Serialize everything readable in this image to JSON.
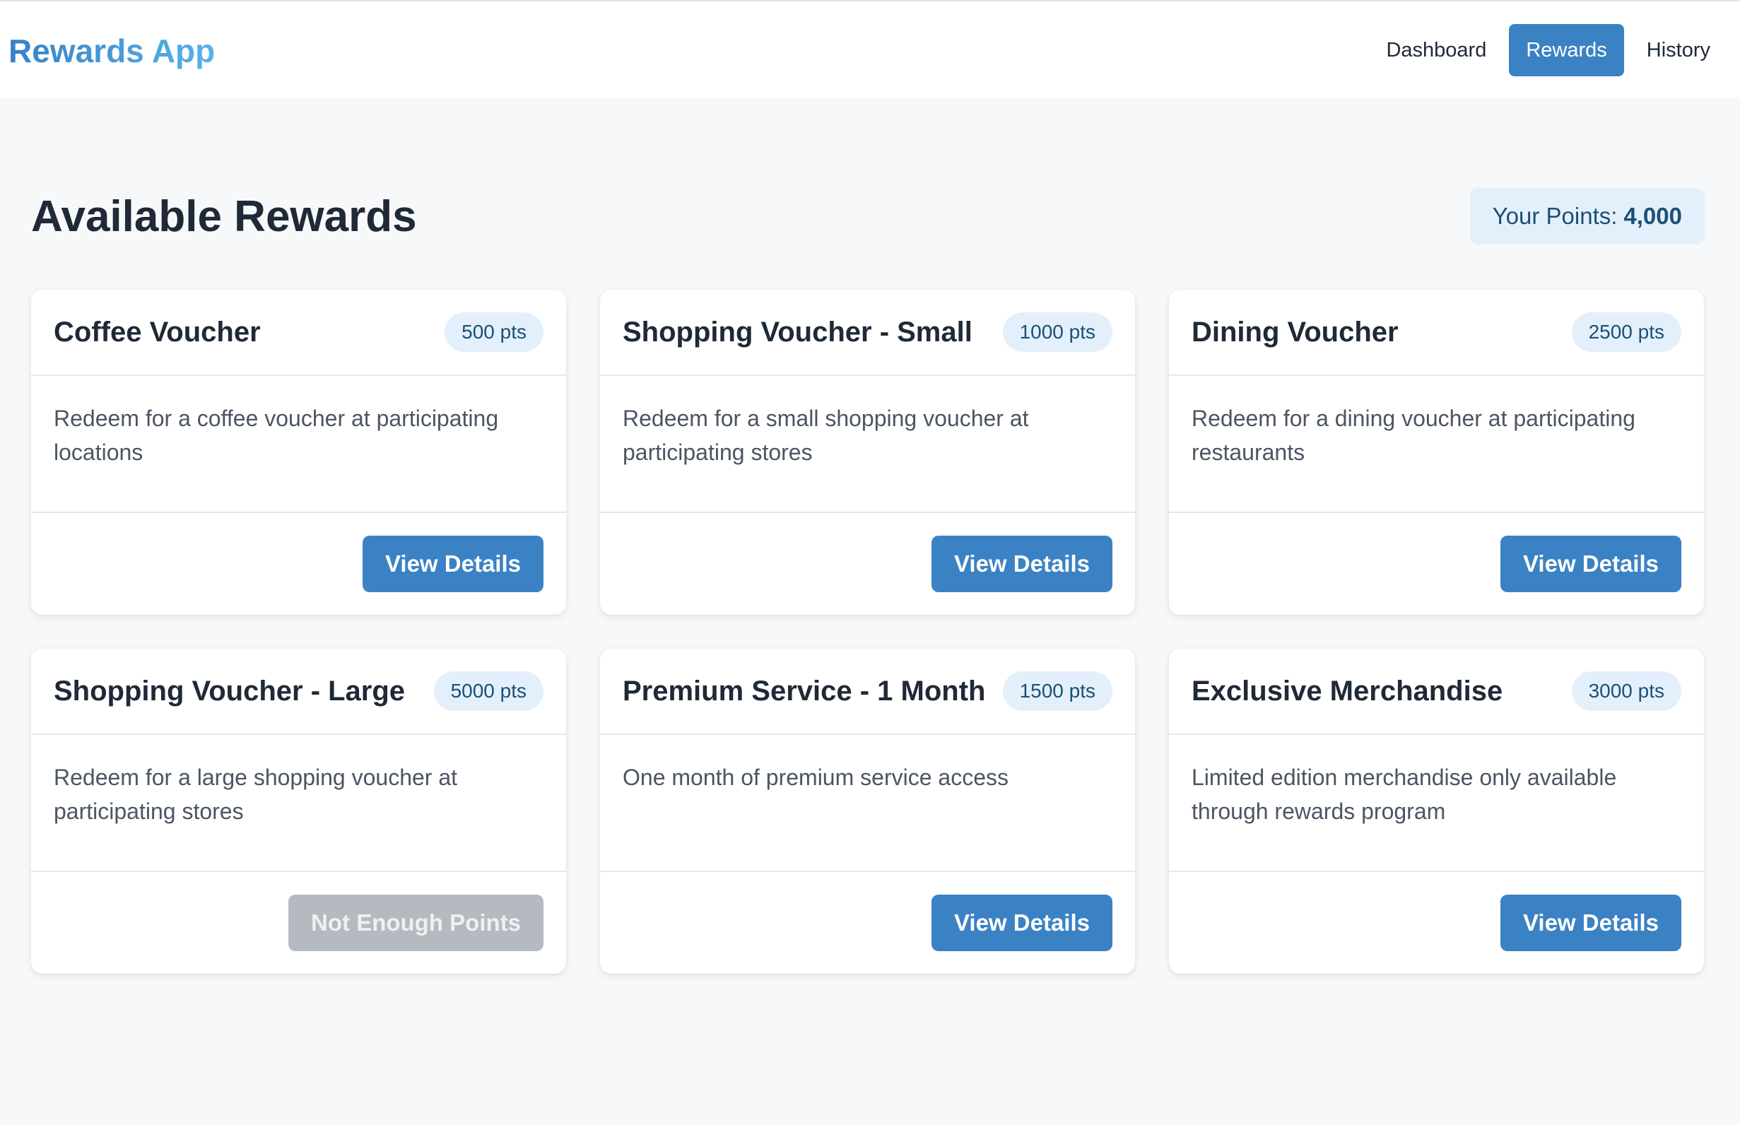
{
  "app": {
    "brand": "Rewards App"
  },
  "nav": {
    "items": [
      {
        "label": "Dashboard",
        "active": false
      },
      {
        "label": "Rewards",
        "active": true
      },
      {
        "label": "History",
        "active": false
      }
    ]
  },
  "main": {
    "title": "Available Rewards",
    "points_label": "Your Points:",
    "points_value": "4,000"
  },
  "rewards": [
    {
      "title": "Coffee Voucher",
      "points": "500 pts",
      "description": "Redeem for a coffee voucher at participating locations",
      "button_label": "View Details",
      "button_enabled": true
    },
    {
      "title": "Shopping Voucher - Small",
      "points": "1000 pts",
      "description": "Redeem for a small shopping voucher at participating stores",
      "button_label": "View Details",
      "button_enabled": true
    },
    {
      "title": "Dining Voucher",
      "points": "2500 pts",
      "description": "Redeem for a dining voucher at participating restaurants",
      "button_label": "View Details",
      "button_enabled": true
    },
    {
      "title": "Shopping Voucher - Large",
      "points": "5000 pts",
      "description": "Redeem for a large shopping voucher at participating stores",
      "button_label": "Not Enough Points",
      "button_enabled": false
    },
    {
      "title": "Premium Service - 1 Month",
      "points": "1500 pts",
      "description": "One month of premium service access",
      "button_label": "View Details",
      "button_enabled": true
    },
    {
      "title": "Exclusive Merchandise",
      "points": "3000 pts",
      "description": "Limited edition merchandise only available through rewards program",
      "button_label": "View Details",
      "button_enabled": true
    }
  ],
  "colors": {
    "accent": "#3b82c4",
    "brand_gradient_start": "#3780c7",
    "brand_gradient_end": "#58b3e6",
    "badge_background": "#e3f0fb",
    "badge_text": "#1c4f75",
    "disabled_button": "#b5bac1",
    "page_background": "#f7f8fa"
  }
}
